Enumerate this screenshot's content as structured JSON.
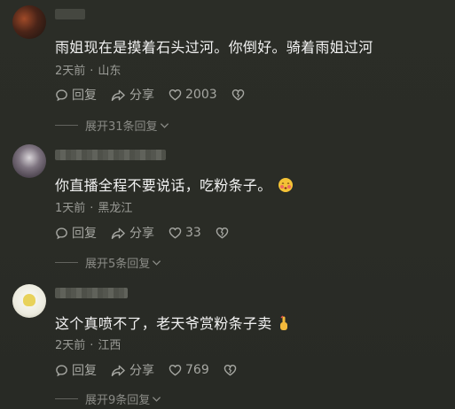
{
  "comments": [
    {
      "text": "雨姐现在是摸着石头过河。你倒好。骑着雨姐过河",
      "time": "2天前",
      "location": "山东",
      "reply_label": "回复",
      "share_label": "分享",
      "likes": "2003",
      "expand_label": "展开31条回复"
    },
    {
      "text": "你直播全程不要说话，吃粉条子。",
      "time": "1天前",
      "location": "黑龙江",
      "reply_label": "回复",
      "share_label": "分享",
      "likes": "33",
      "expand_label": "展开5条回复"
    },
    {
      "text": "这个真喷不了，老天爷赏粉条子卖",
      "time": "2天前",
      "location": "江西",
      "reply_label": "回复",
      "share_label": "分享",
      "likes": "769",
      "expand_label": "展开9条回复"
    }
  ],
  "icons": {
    "reply": "reply-bubble-icon",
    "share": "share-arrow-icon",
    "like": "heart-icon",
    "dislike": "broken-heart-icon",
    "expand": "chevron-down-icon"
  },
  "colors": {
    "background": "#2a2c26",
    "text": "#f2f2f2",
    "meta": "#9a9b96"
  }
}
